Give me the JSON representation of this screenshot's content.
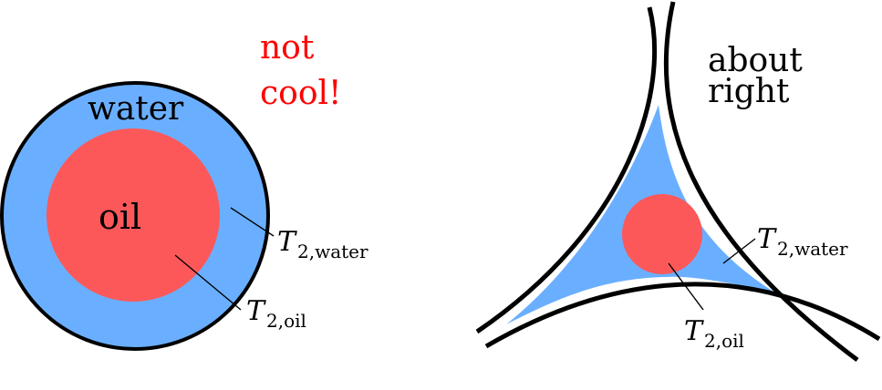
{
  "colors": {
    "water": "#6aafff",
    "oil": "#fc585a",
    "outline": "#000000",
    "warning_text": "#ff0000",
    "normal_text": "#000000"
  },
  "left_panel": {
    "outer_label": "water",
    "inner_label": "oil",
    "verdict_line1": "not",
    "verdict_line2": "cool!",
    "water_relaxation": {
      "symbol": "T",
      "subscript": "2,water"
    },
    "oil_relaxation": {
      "symbol": "T",
      "subscript": "2,oil"
    }
  },
  "right_panel": {
    "verdict_line1": "about",
    "verdict_line2": "right",
    "water_relaxation": {
      "symbol": "T",
      "subscript": "2,water"
    },
    "oil_relaxation": {
      "symbol": "T",
      "subscript": "2,oil"
    }
  }
}
